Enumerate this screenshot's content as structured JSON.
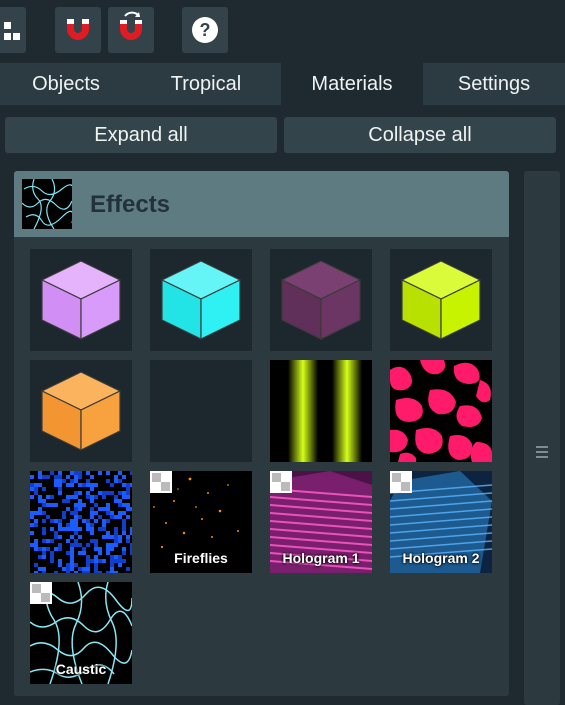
{
  "tabs": [
    {
      "label": "Objects"
    },
    {
      "label": "Tropical"
    },
    {
      "label": "Materials"
    },
    {
      "label": "Settings"
    }
  ],
  "active_tab": "Materials",
  "actions": {
    "expand": "Expand all",
    "collapse": "Collapse all"
  },
  "category": {
    "title": "Effects"
  },
  "materials": [
    {
      "name": "",
      "color": "#d99bf9"
    },
    {
      "name": "",
      "color": "#2ff0f2"
    },
    {
      "name": "",
      "color": "#6b3664"
    },
    {
      "name": "",
      "color": "#c7f200"
    },
    {
      "name": "",
      "color": "#f7a13f"
    },
    {
      "name": ""
    },
    {
      "name": "",
      "color": "#c7f200"
    },
    {
      "name": "",
      "color": "#ff1a6a"
    },
    {
      "name": "",
      "color": "#1a5cff"
    },
    {
      "name": "Fireflies"
    },
    {
      "name": "Hologram 1"
    },
    {
      "name": "Hologram 2"
    },
    {
      "name": "Caustic"
    }
  ]
}
